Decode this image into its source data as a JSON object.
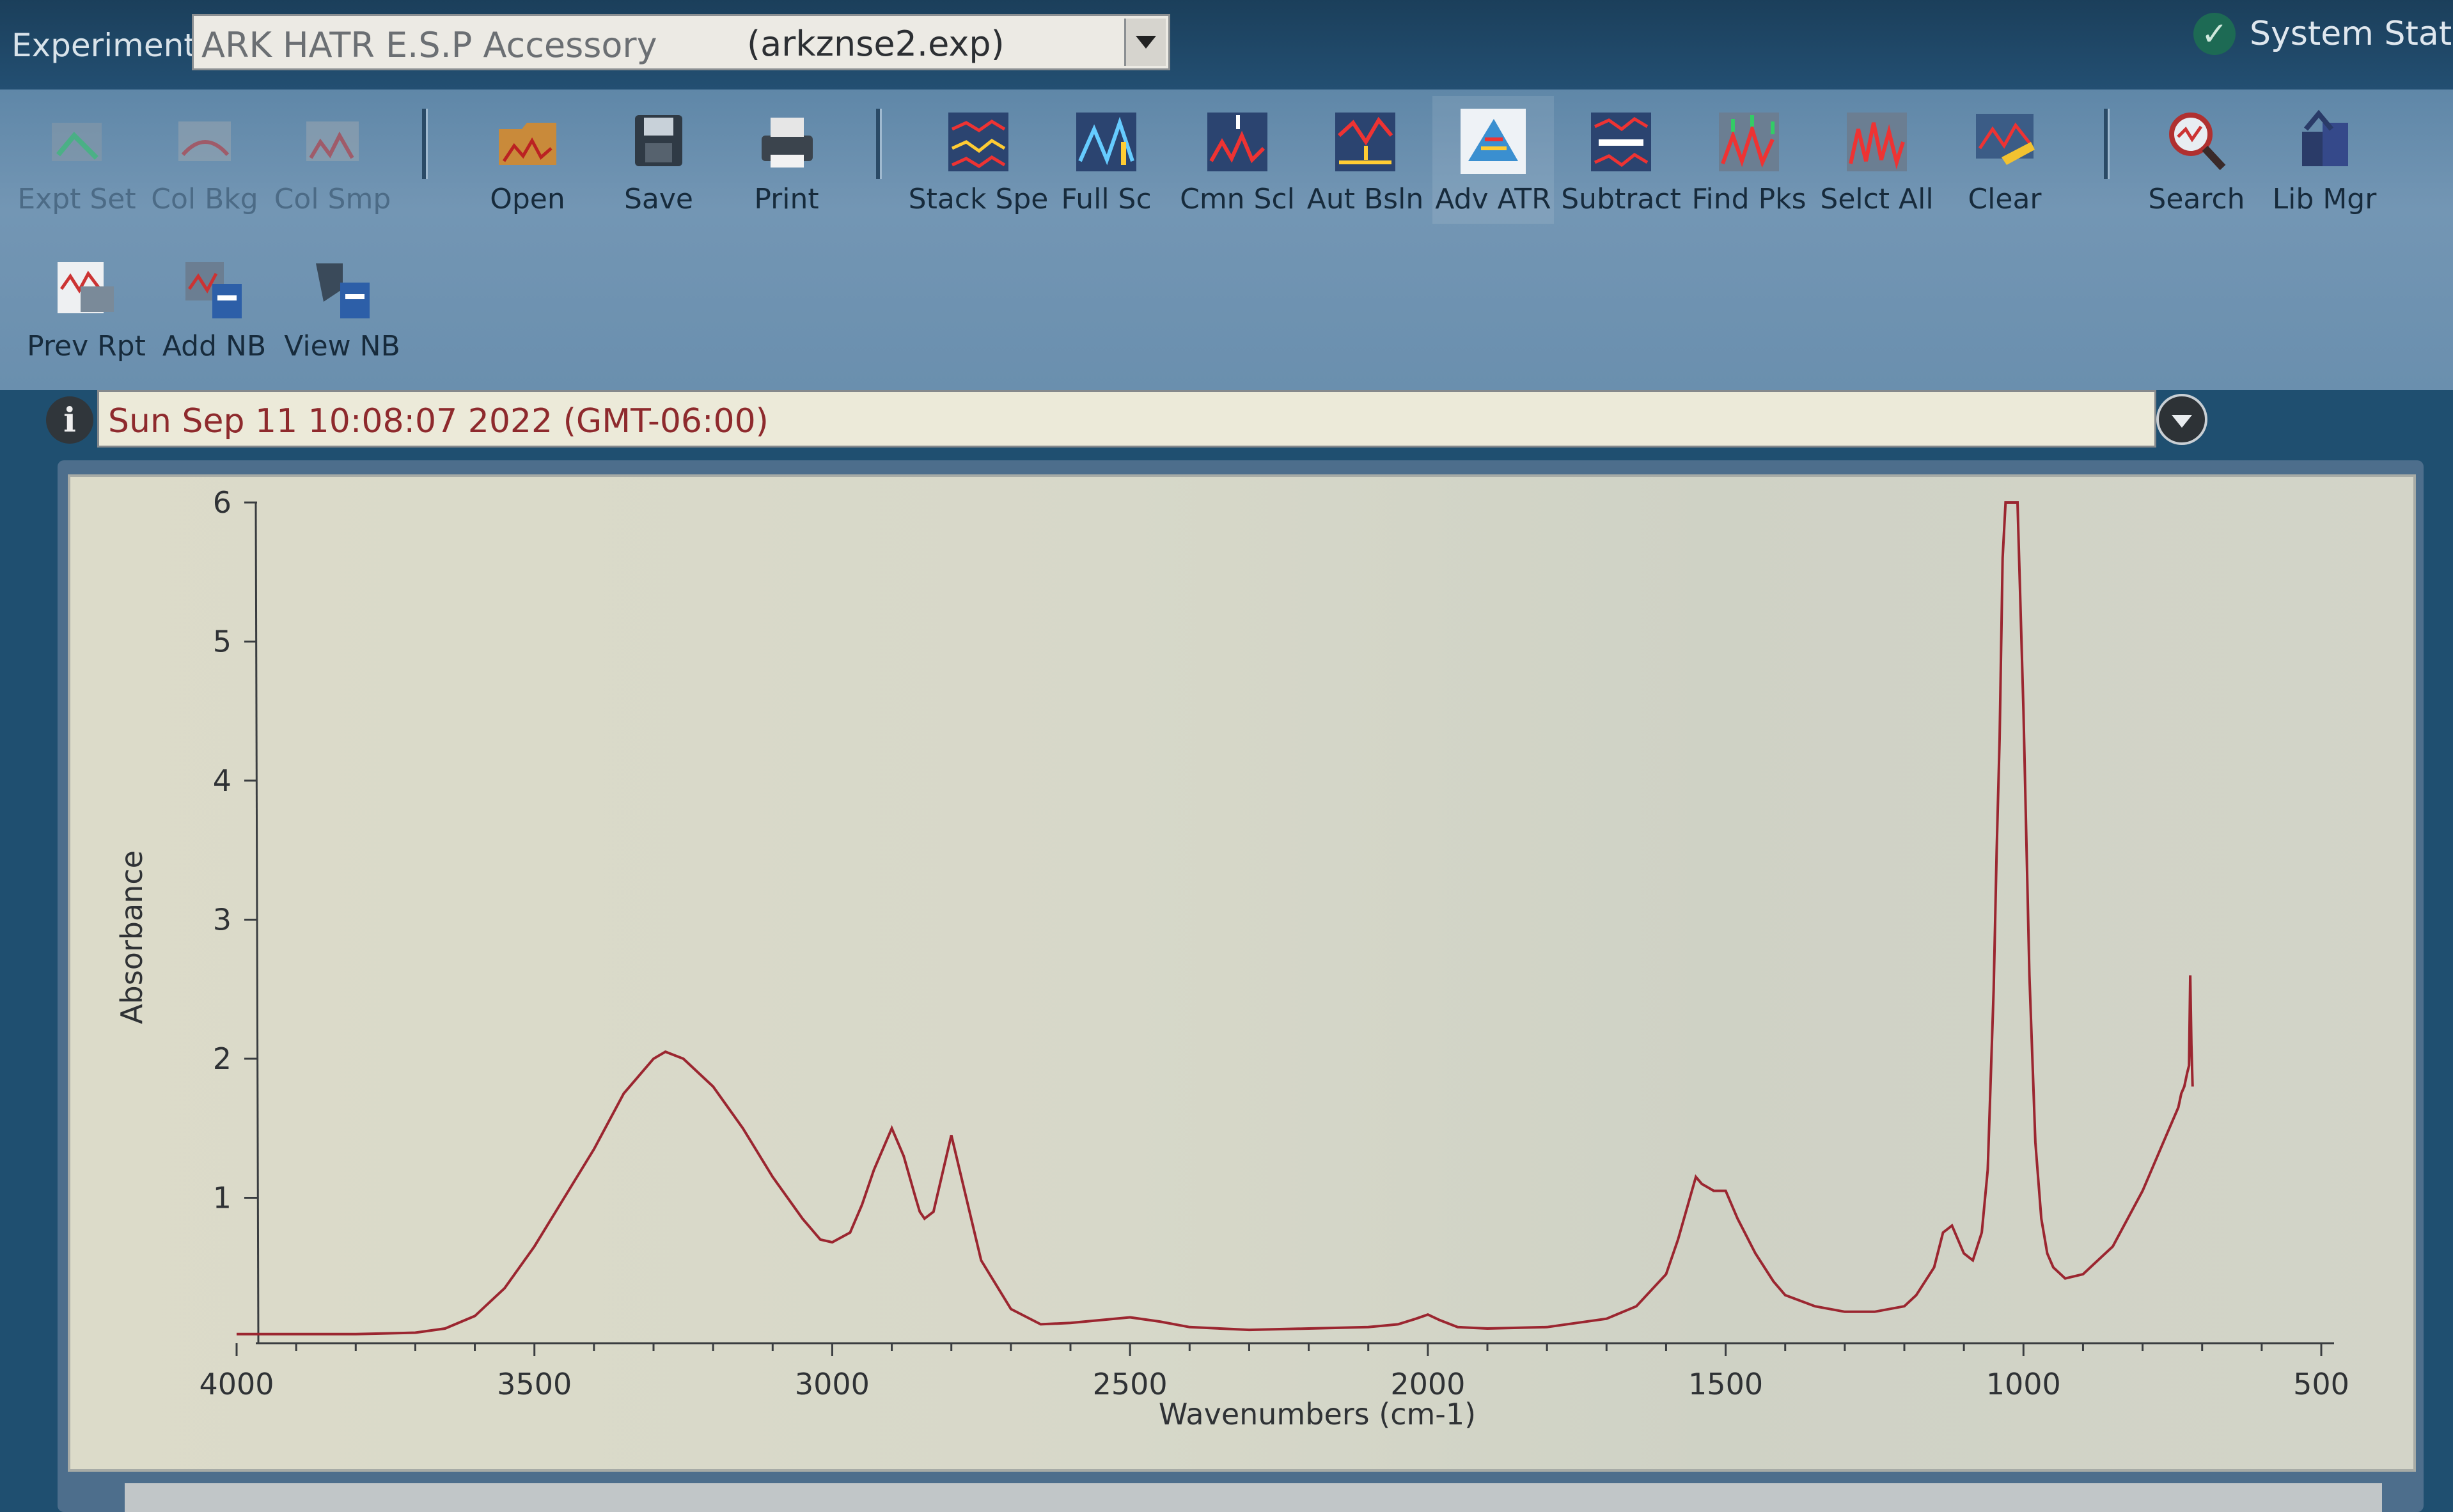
{
  "header": {
    "experiment_label": "Experiment:",
    "experiment_name": "ARK HATR E.S.P Accessory",
    "experiment_file": "(arkznse2.exp)",
    "system_status": "System Status"
  },
  "toolbar": {
    "row1": [
      {
        "label": "Expt Set",
        "icon": "experiment-setup-icon",
        "enabled": false
      },
      {
        "label": "Col Bkg",
        "icon": "collect-background-icon",
        "enabled": false
      },
      {
        "label": "Col Smp",
        "icon": "collect-sample-icon",
        "enabled": false
      },
      {
        "label": "Open",
        "icon": "open-folder-icon",
        "enabled": true
      },
      {
        "label": "Save",
        "icon": "save-disk-icon",
        "enabled": true
      },
      {
        "label": "Print",
        "icon": "printer-icon",
        "enabled": true
      },
      {
        "label": "Stack Spe",
        "icon": "stack-spectra-icon",
        "enabled": true
      },
      {
        "label": "Full Sc",
        "icon": "full-scale-icon",
        "enabled": true
      },
      {
        "label": "Cmn Scl",
        "icon": "common-scale-icon",
        "enabled": true
      },
      {
        "label": "Aut Bsln",
        "icon": "auto-baseline-icon",
        "enabled": true
      },
      {
        "label": "Adv ATR",
        "icon": "advanced-atr-icon",
        "enabled": true,
        "active": true
      },
      {
        "label": "Subtract",
        "icon": "subtract-icon",
        "enabled": true
      },
      {
        "label": "Find Pks",
        "icon": "find-peaks-icon",
        "enabled": true
      },
      {
        "label": "Selct All",
        "icon": "select-all-icon",
        "enabled": true
      },
      {
        "label": "Clear",
        "icon": "clear-icon",
        "enabled": true
      },
      {
        "label": "Search",
        "icon": "search-magnifier-icon",
        "enabled": true
      },
      {
        "label": "Lib Mgr",
        "icon": "library-manager-icon",
        "enabled": true
      }
    ],
    "row2": [
      {
        "label": "Prev Rpt",
        "icon": "preview-report-icon",
        "enabled": true
      },
      {
        "label": "Add NB",
        "icon": "add-notebook-icon",
        "enabled": true
      },
      {
        "label": "View NB",
        "icon": "view-notebook-icon",
        "enabled": true
      }
    ]
  },
  "spectrum_bar": {
    "title": "Sun Sep 11 10:08:07 2022 (GMT-06:00)"
  },
  "colors": {
    "spectrum_line": "#9b2630",
    "title_text": "#8e2a2d"
  },
  "chart_data": {
    "type": "line",
    "title": "",
    "xlabel": "Wavenumbers (cm-1)",
    "ylabel": "Absorbance",
    "xlim": [
      4000,
      500
    ],
    "ylim": [
      0,
      6
    ],
    "x_reversed": true,
    "grid": false,
    "xticks": [
      4000,
      3500,
      3000,
      2500,
      2000,
      1500,
      1000,
      500
    ],
    "yticks": [
      1,
      2,
      3,
      4,
      5,
      6
    ],
    "series": [
      {
        "x": [
          4000,
          3800,
          3700,
          3650,
          3600,
          3550,
          3500,
          3450,
          3400,
          3350,
          3300,
          3280,
          3250,
          3200,
          3150,
          3100,
          3050,
          3020,
          3000,
          2970,
          2950,
          2930,
          2920,
          2900,
          2880,
          2870,
          2860,
          2853,
          2845,
          2830,
          2800,
          2750,
          2700,
          2650,
          2600,
          2550,
          2500,
          2450,
          2400,
          2300,
          2200,
          2100,
          2050,
          2020,
          2000,
          1980,
          1950,
          1900,
          1800,
          1700,
          1650,
          1600,
          1580,
          1560,
          1550,
          1540,
          1520,
          1500,
          1480,
          1450,
          1420,
          1400,
          1350,
          1300,
          1250,
          1200,
          1180,
          1150,
          1135,
          1120,
          1100,
          1085,
          1070,
          1060,
          1050,
          1045,
          1040,
          1035,
          1030,
          1025,
          1020,
          1015,
          1010,
          1000,
          990,
          980,
          970,
          960,
          950,
          930,
          900,
          850,
          800,
          780,
          760,
          750,
          745,
          740,
          735,
          730,
          725,
          722,
          720,
          718,
          716
        ],
        "y": [
          0.02,
          0.02,
          0.03,
          0.06,
          0.15,
          0.35,
          0.65,
          1.0,
          1.35,
          1.75,
          2.0,
          2.05,
          2.0,
          1.8,
          1.5,
          1.15,
          0.85,
          0.7,
          0.68,
          0.75,
          0.95,
          1.2,
          1.3,
          1.5,
          1.3,
          1.15,
          1.0,
          0.9,
          0.85,
          0.9,
          1.45,
          0.55,
          0.2,
          0.09,
          0.1,
          0.12,
          0.14,
          0.11,
          0.07,
          0.05,
          0.06,
          0.07,
          0.09,
          0.13,
          0.16,
          0.12,
          0.07,
          0.06,
          0.07,
          0.13,
          0.22,
          0.45,
          0.7,
          1.0,
          1.15,
          1.1,
          1.05,
          1.05,
          0.85,
          0.6,
          0.4,
          0.3,
          0.22,
          0.18,
          0.18,
          0.22,
          0.3,
          0.5,
          0.75,
          0.8,
          0.6,
          0.55,
          0.75,
          1.2,
          2.5,
          3.5,
          4.3,
          5.6,
          6.0,
          6.0,
          6.0,
          6.0,
          6.0,
          4.5,
          2.6,
          1.4,
          0.85,
          0.6,
          0.5,
          0.42,
          0.45,
          0.65,
          1.05,
          1.25,
          1.45,
          1.55,
          1.6,
          1.65,
          1.75,
          1.8,
          1.9,
          1.95,
          2.6,
          2.1,
          1.8
        ]
      }
    ]
  }
}
